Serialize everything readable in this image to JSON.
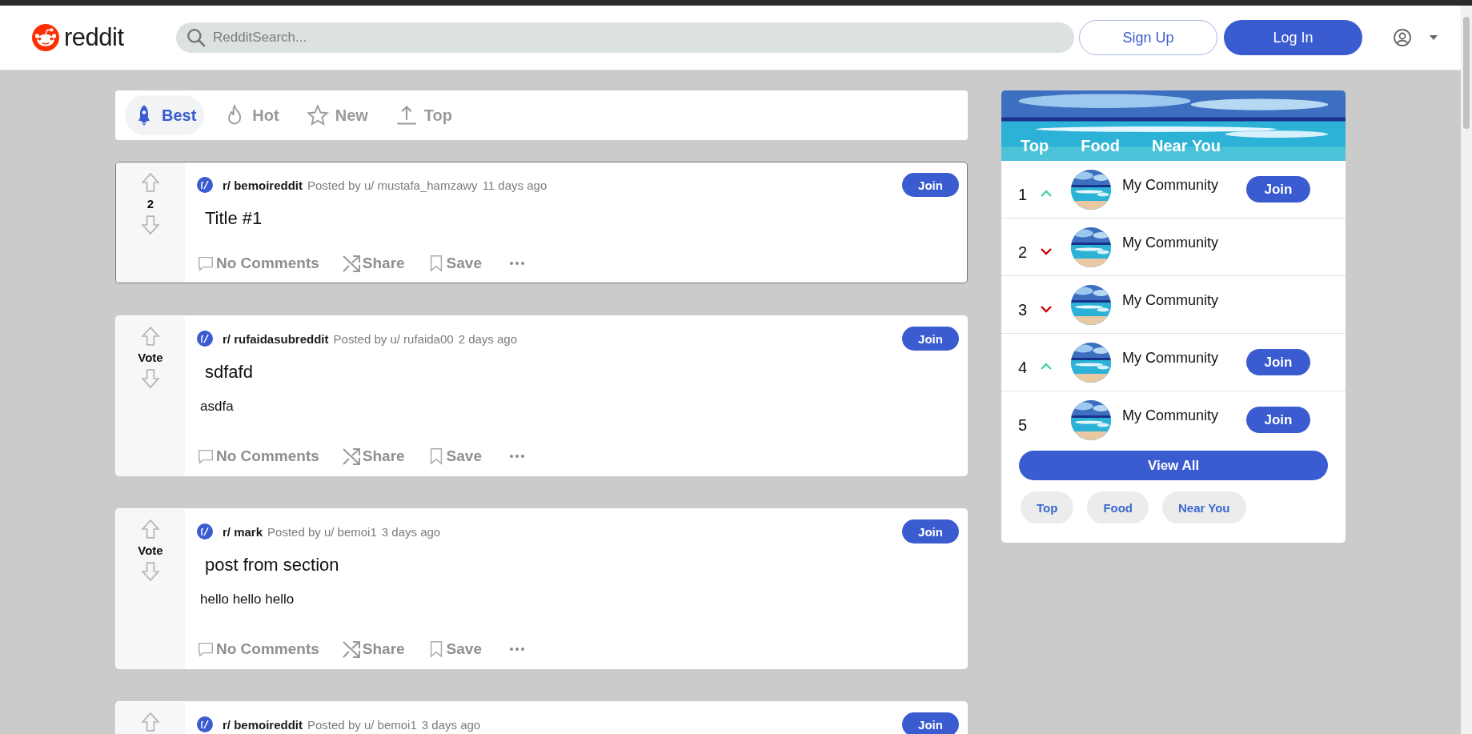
{
  "header": {
    "logo_text": "reddit",
    "search": {
      "placeholder": "RedditSearch..."
    },
    "buttons": [
      "Sign Up",
      "Log In"
    ]
  },
  "sort_tabs": [
    {
      "label": "Best",
      "selected": true
    },
    {
      "label": "Hot",
      "selected": false
    },
    {
      "label": "New",
      "selected": false
    },
    {
      "label": "Top",
      "selected": false
    }
  ],
  "posts": [
    {
      "votes": "2",
      "subreddit": "r/ bemoireddit",
      "posted_by": "Posted by u/ mustafa_hamzawy",
      "time": "11 days ago",
      "join": "Join",
      "title": "Title #1",
      "actions": [
        "No Comments",
        "Share",
        "Save"
      ],
      "highlighted": true
    },
    {
      "votes": "Vote",
      "subreddit": "r/ rufaidasubreddit",
      "posted_by": "Posted by u/ rufaida00",
      "time": "2 days ago",
      "join": "Join",
      "title": "sdfafd",
      "body": "asdfa",
      "actions": [
        "No Comments",
        "Share",
        "Save"
      ],
      "highlighted": false
    },
    {
      "votes": "Vote",
      "subreddit": "r/ mark",
      "posted_by": "Posted by u/ bemoi1",
      "time": "3 days ago",
      "join": "Join",
      "title": "post from section",
      "body": "hello hello hello",
      "actions": [
        "No Comments",
        "Share",
        "Save"
      ],
      "highlighted": false
    },
    {
      "subreddit": "r/ bemoireddit",
      "posted_by": "Posted by u/ bemoi1",
      "time": "3 days ago",
      "join": "Join",
      "highlighted": false
    }
  ],
  "sidebar": {
    "banner_tabs": [
      "Top",
      "Food",
      "Near You"
    ],
    "communities": [
      {
        "rank": "1",
        "kind": "rising",
        "name": "My Community",
        "join": "Join"
      },
      {
        "rank": "2",
        "kind": "falling",
        "name": "My Community"
      },
      {
        "rank": "3",
        "kind": "falling",
        "name": "My Community"
      },
      {
        "rank": "4",
        "kind": "rising",
        "name": "My Community",
        "join": "Join"
      },
      {
        "rank": "5",
        "kind": "steady",
        "name": "My Community",
        "join": "Join"
      }
    ],
    "view_all": "View All",
    "chips": [
      "Top",
      "Food",
      "Near You"
    ]
  }
}
